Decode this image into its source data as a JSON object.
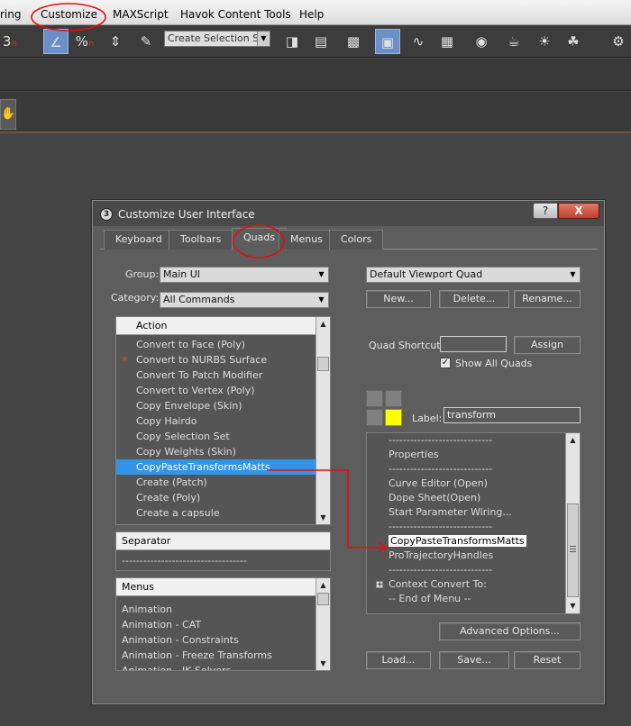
{
  "menubar": {
    "items": [
      "ring",
      "Customize",
      "MAXScript",
      "Havok Content Tools",
      "Help"
    ]
  },
  "toolbar": {
    "buttons": [
      "3",
      "%",
      "Create Selection Se"
    ],
    "selection_set_placeholder": "Create Selection Se"
  },
  "dialog": {
    "title": "Customize User Interface",
    "help_label": "?",
    "close_label": "X",
    "tabs": [
      "Keyboard",
      "Toolbars",
      "Quads",
      "Menus",
      "Colors"
    ],
    "active_tab": "Quads",
    "group_label": "Group:",
    "group_value": "Main UI",
    "category_label": "Category:",
    "category_value": "All Commands",
    "action_list": {
      "header": "Action",
      "items": [
        {
          "label": "Convert to Face (Poly)",
          "icon": ""
        },
        {
          "label": "Convert to NURBS Surface",
          "icon": "nurbs-icon"
        },
        {
          "label": "Convert To Patch Modifier",
          "icon": ""
        },
        {
          "label": "Convert to Vertex (Poly)",
          "icon": ""
        },
        {
          "label": "Copy Envelope (Skin)",
          "icon": ""
        },
        {
          "label": "Copy Hairdo",
          "icon": ""
        },
        {
          "label": "Copy Selection Set",
          "icon": ""
        },
        {
          "label": "Copy Weights (Skin)",
          "icon": ""
        },
        {
          "label": "CopyPasteTransformsMatts",
          "icon": "",
          "selected": true
        },
        {
          "label": "Create (Patch)",
          "icon": ""
        },
        {
          "label": "Create (Poly)",
          "icon": ""
        },
        {
          "label": "Create a capsule",
          "icon": ""
        }
      ]
    },
    "separator_list": {
      "header": "Separator",
      "item": "-----------------------------------"
    },
    "menus_list": {
      "header": "Menus",
      "items": [
        "Animation",
        "Animation - CAT",
        "Animation - Constraints",
        "Animation - Freeze Transforms",
        "Animation - IK Solvers"
      ]
    },
    "quad_select": "Default Viewport Quad",
    "new_button": "New...",
    "delete_button": "Delete...",
    "rename_button": "Rename...",
    "quad_shortcut_label": "Quad Shortcut:",
    "quad_shortcut_value": "",
    "assign_button": "Assign",
    "show_all_quads_label": "Show All Quads",
    "show_all_quads_checked": true,
    "label_label": "Label:",
    "label_value": "transform",
    "quad_colors": [
      "#808080",
      "#808080",
      "#808080",
      "#ffff00"
    ],
    "quad_items": [
      {
        "label": "-----------------------------"
      },
      {
        "label": "Properties"
      },
      {
        "label": "-----------------------------"
      },
      {
        "label": "Curve Editor (Open)"
      },
      {
        "label": "Dope Sheet(Open)"
      },
      {
        "label": "Start Parameter Wiring..."
      },
      {
        "label": "-----------------------------"
      },
      {
        "label": "CopyPasteTransformsMatts",
        "highlighted": true
      },
      {
        "label": "ProTrajectoryHandles"
      },
      {
        "label": "-----------------------------"
      },
      {
        "label": "Context Convert To:",
        "expandable": true
      },
      {
        "label": "-- End of Menu --"
      }
    ],
    "advanced_button": "Advanced Options...",
    "load_button": "Load...",
    "save_button": "Save...",
    "reset_button": "Reset"
  },
  "annotation_color": "#e01010"
}
